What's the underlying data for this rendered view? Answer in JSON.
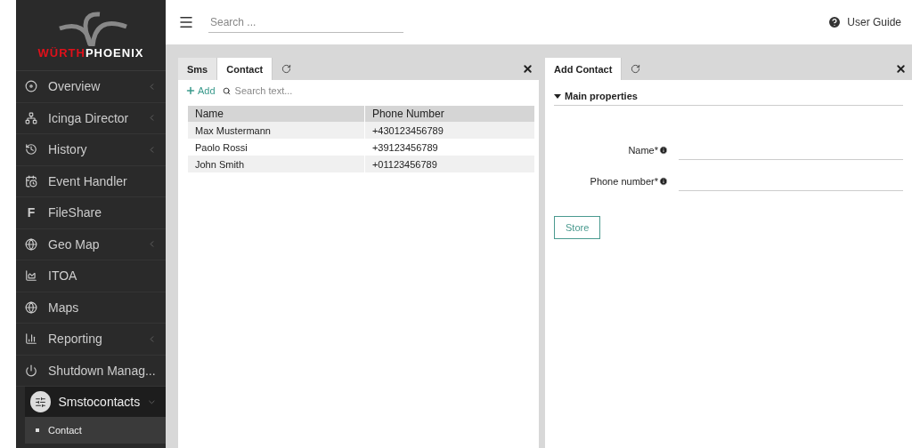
{
  "logo": {
    "part1": "WÜRTH",
    "part2": "PHOENIX"
  },
  "sidebar": {
    "items": [
      {
        "label": "Overview",
        "has_submenu": true
      },
      {
        "label": "Icinga Director",
        "has_submenu": true
      },
      {
        "label": "History",
        "has_submenu": true
      },
      {
        "label": "Event Handler",
        "has_submenu": false
      },
      {
        "label": "FileShare",
        "icon_text": "F",
        "has_submenu": false
      },
      {
        "label": "Geo Map",
        "has_submenu": true
      },
      {
        "label": "ITOA",
        "has_submenu": false
      },
      {
        "label": "Maps",
        "has_submenu": false
      },
      {
        "label": "Reporting",
        "has_submenu": true
      },
      {
        "label": "Shutdown Manag...",
        "has_submenu": false
      }
    ],
    "active_section": {
      "label": "Smstocontacts",
      "expanded": true,
      "children": [
        {
          "label": "Contact",
          "selected": true
        }
      ]
    }
  },
  "topbar": {
    "search_placeholder": "Search ...",
    "help_label": "User Guide"
  },
  "left_panel": {
    "tabs": [
      {
        "label": "Sms",
        "selected": false
      },
      {
        "label": "Contact",
        "selected": true
      }
    ],
    "add_label": "Add",
    "search_placeholder": "Search text...",
    "table": {
      "columns": [
        "Name",
        "Phone Number"
      ],
      "rows": [
        [
          "Max Mustermann",
          "+430123456789"
        ],
        [
          "Paolo Rossi",
          "+39123456789"
        ],
        [
          "John Smith",
          "+01123456789"
        ]
      ]
    }
  },
  "right_panel": {
    "tabs": [
      {
        "label": "Add Contact",
        "selected": true
      }
    ],
    "section": {
      "label": "Main properties",
      "expanded": true
    },
    "fields": [
      {
        "label": "Name*"
      },
      {
        "label": "Phone number*"
      }
    ],
    "submit": "Store"
  }
}
